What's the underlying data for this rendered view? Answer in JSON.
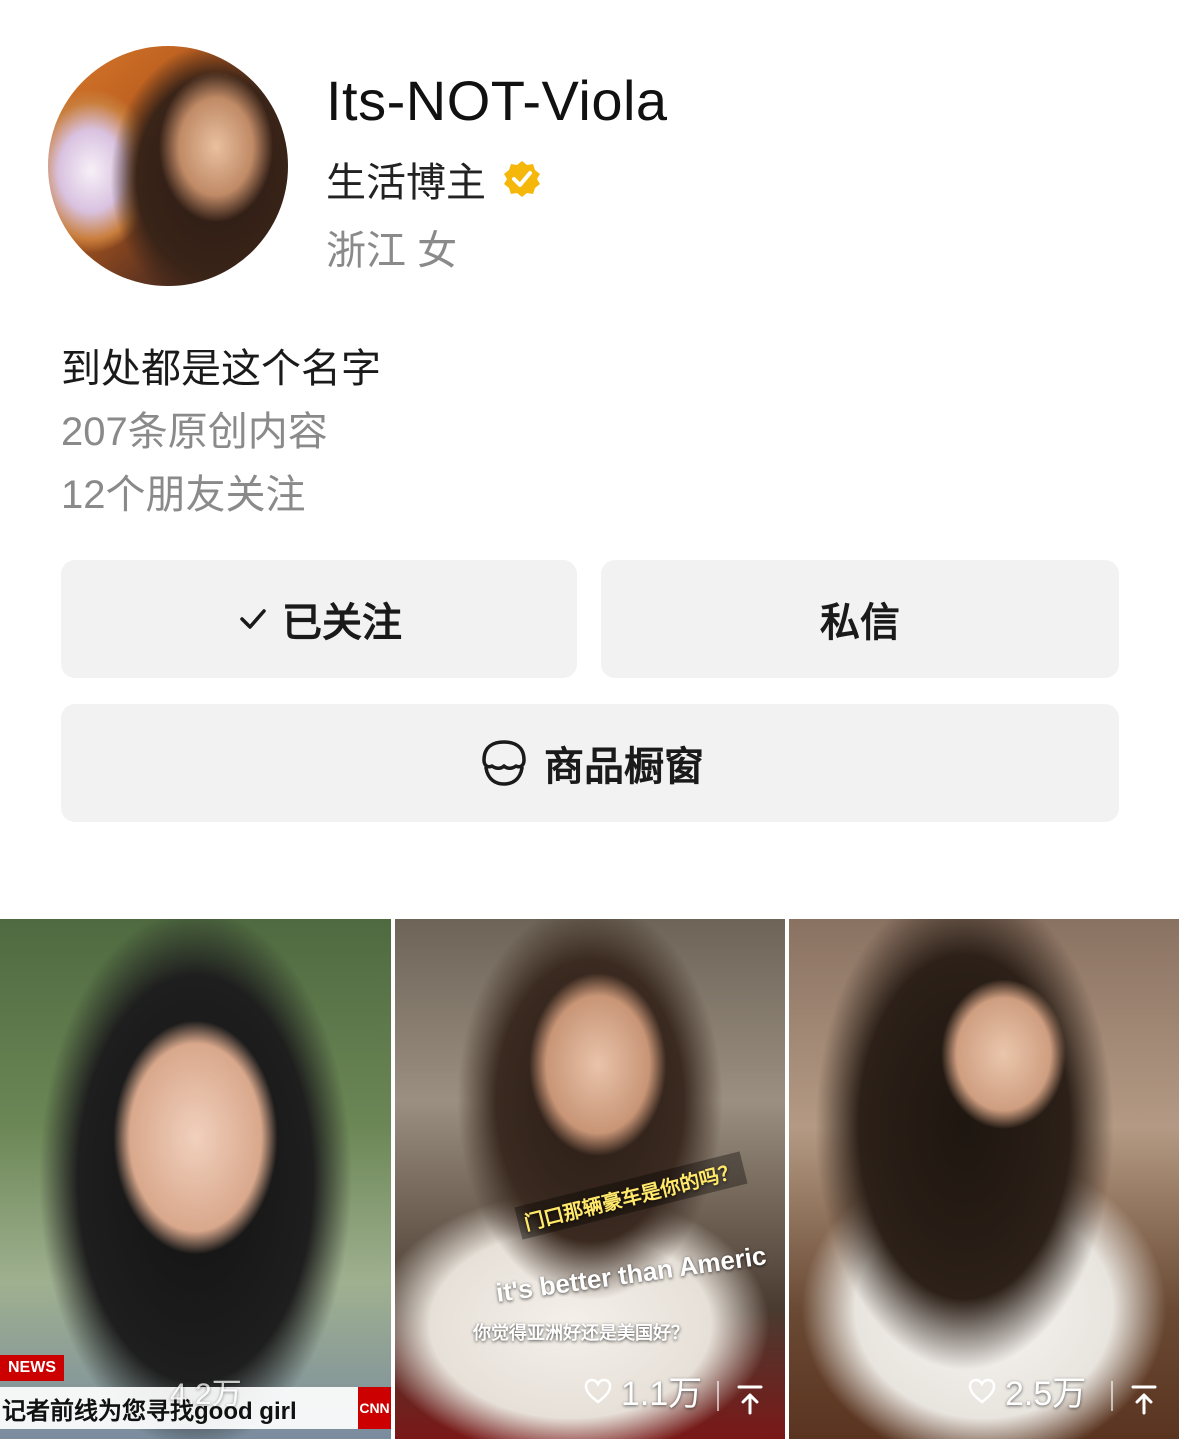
{
  "profile": {
    "name": "Its-NOT-Viola",
    "role": "生活博主",
    "location": "浙江  女",
    "bio": "到处都是这个名字",
    "original_content": "207条原创内容",
    "friends_following": "12个朋友关注"
  },
  "actions": {
    "follow_label": "已关注",
    "message_label": "私信",
    "shop_label": "商品橱窗"
  },
  "videos": [
    {
      "likes": "4.2万",
      "news_badge": "NEWS",
      "news_caption": "记者前线为您寻找good girl",
      "news_logo": "CNN"
    },
    {
      "likes": "1.1万",
      "caption_top": "门口那辆豪车是你的吗？",
      "caption_mid": "it's better than Americ",
      "caption_bottom": "你觉得亚洲好还是美国好？"
    },
    {
      "likes": "2.5万"
    }
  ],
  "colors": {
    "verified_badge": "#f5b80a",
    "button_bg": "#f2f2f2",
    "secondary_text": "#8a8a8a"
  }
}
